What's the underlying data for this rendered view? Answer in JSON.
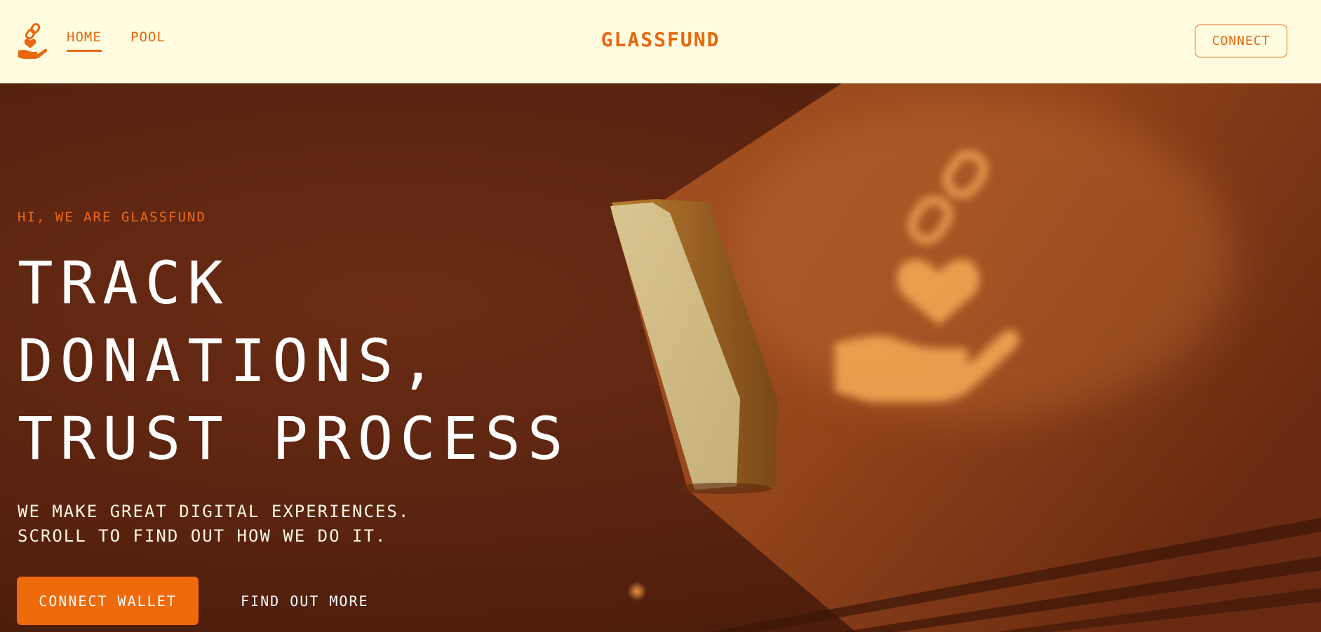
{
  "header": {
    "nav": [
      {
        "label": "HOME",
        "active": true
      },
      {
        "label": "POOL",
        "active": false
      }
    ],
    "brand": "GLASSFUND",
    "connect_label": "CONNECT",
    "logo_icon": "hand-heart-chain-icon"
  },
  "hero": {
    "eyebrow": "HI, WE ARE GLASSFUND",
    "headline_lines": [
      "TRACK",
      "DONATIONS,",
      "TRUST PROCESS"
    ],
    "subtext_lines": [
      "WE MAKE GREAT DIGITAL EXPERIENCES.",
      "SCROLL TO FIND OUT HOW WE DO IT."
    ],
    "primary_cta": "CONNECT WALLET",
    "secondary_cta": "FIND OUT MORE"
  },
  "colors": {
    "accent": "#e8670f",
    "header_bg": "#fffcdf",
    "hero_bg": "#5b2410",
    "cta_bg": "#ef6a0a"
  }
}
